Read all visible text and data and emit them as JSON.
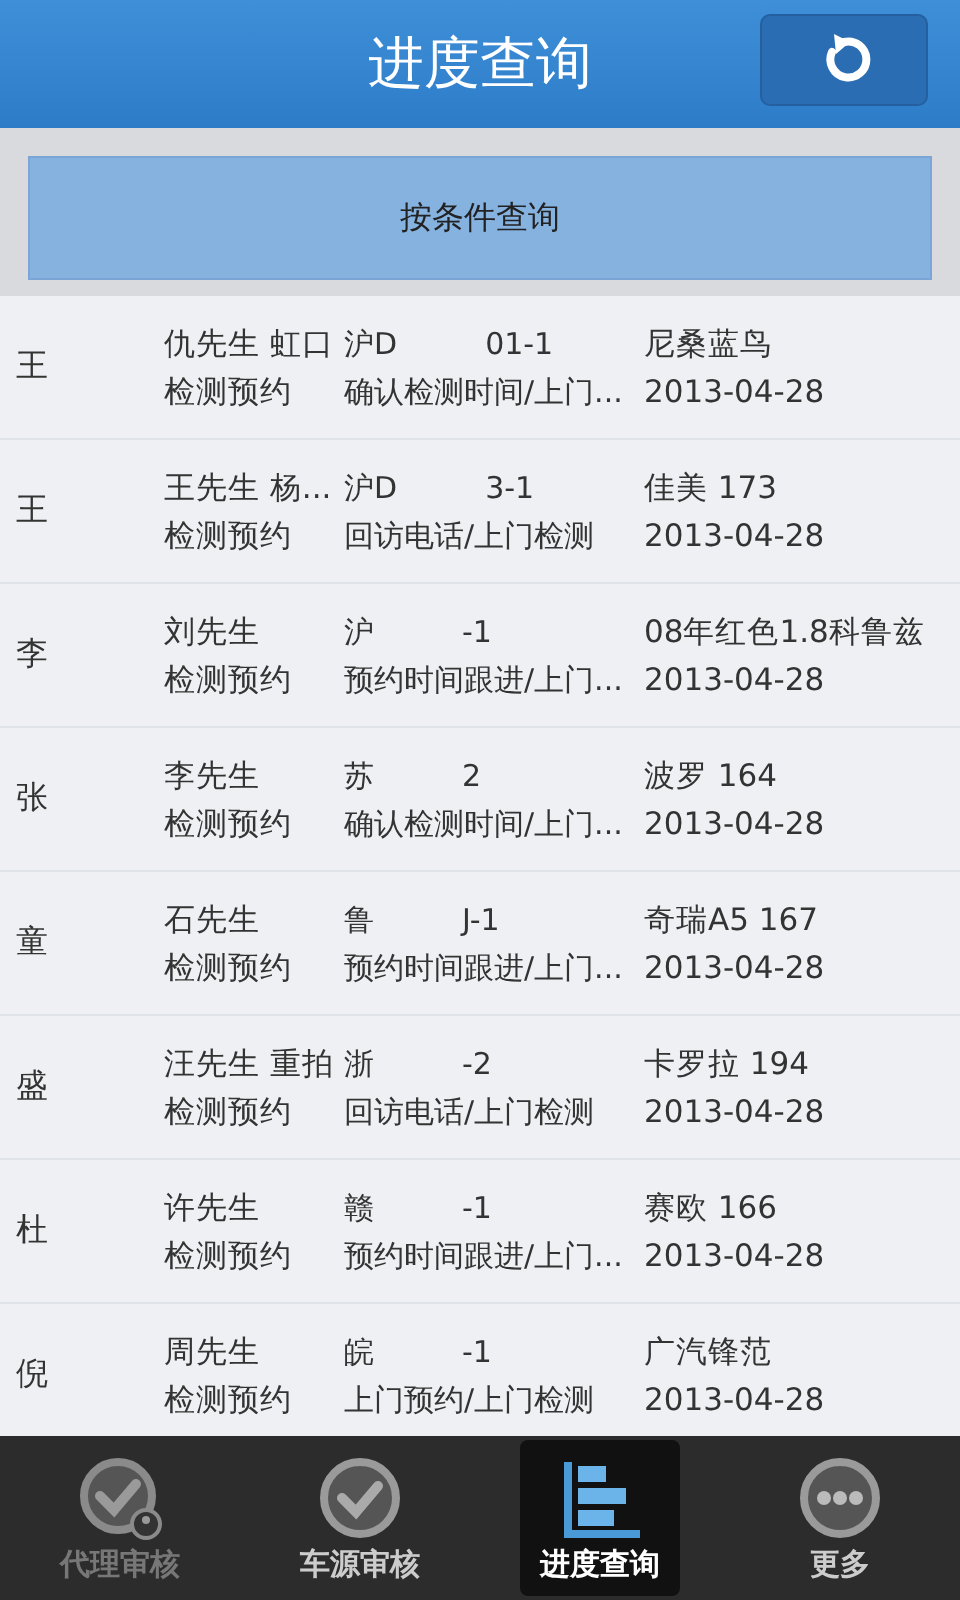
{
  "header": {
    "title": "进度查询"
  },
  "filter_button": "按条件查询",
  "rows": [
    {
      "name": "王",
      "contact": "仇先生 虹口",
      "plate_start": "沪D",
      "plate_end": "01-1",
      "car": "尼桑蓝鸟",
      "service": "检测预约",
      "progress": "确认检测时间/上门...",
      "date": "2013-04-28"
    },
    {
      "name": "王",
      "contact": "王先生 杨...",
      "plate_start": "沪D",
      "plate_end": "3-1",
      "car": "佳美 173",
      "service": "检测预约",
      "progress": "回访电话/上门检测",
      "date": "2013-04-28"
    },
    {
      "name": "李",
      "contact": "刘先生",
      "plate_start": "沪",
      "plate_end": "-1",
      "car": "08年红色1.8科鲁兹",
      "service": "检测预约",
      "progress": "预约时间跟进/上门...",
      "date": "2013-04-28"
    },
    {
      "name": "张",
      "contact": "李先生",
      "plate_start": "苏",
      "plate_end": "2",
      "car": "波罗  164",
      "service": "检测预约",
      "progress": "确认检测时间/上门...",
      "date": "2013-04-28"
    },
    {
      "name": "童",
      "contact": "石先生",
      "plate_start": "鲁",
      "plate_end": "J-1",
      "car": "奇瑞A5 167",
      "service": "检测预约",
      "progress": "预约时间跟进/上门...",
      "date": "2013-04-28"
    },
    {
      "name": "盛",
      "contact": "汪先生 重拍",
      "plate_start": "浙",
      "plate_end": "-2",
      "car": "卡罗拉 194",
      "service": "检测预约",
      "progress": "回访电话/上门检测",
      "date": "2013-04-28"
    },
    {
      "name": "杜",
      "contact": "许先生",
      "plate_start": "赣",
      "plate_end": "-1",
      "car": "赛欧  166",
      "service": "检测预约",
      "progress": "预约时间跟进/上门...",
      "date": "2013-04-28"
    },
    {
      "name": "倪",
      "contact": "周先生",
      "plate_start": "皖",
      "plate_end": "-1",
      "car": "广汽锋范",
      "service": "检测预约",
      "progress": "上门预约/上门检测",
      "date": "2013-04-28"
    }
  ],
  "tabs": [
    {
      "label": "代理审核",
      "kind": "agent",
      "selected": false,
      "disabled": true
    },
    {
      "label": "车源审核",
      "kind": "check",
      "selected": false,
      "disabled": false
    },
    {
      "label": "进度查询",
      "kind": "chart",
      "selected": true,
      "disabled": false
    },
    {
      "label": "更多",
      "kind": "more",
      "selected": false,
      "disabled": false
    }
  ]
}
